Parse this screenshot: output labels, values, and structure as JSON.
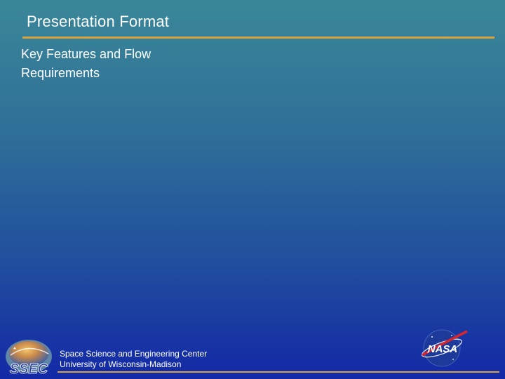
{
  "slide": {
    "title": "Presentation Format",
    "body_lines": [
      "Key Features and Flow",
      "Requirements"
    ]
  },
  "footer": {
    "org_line1": "Space Science and Engineering Center",
    "org_line2": "University of Wisconsin-Madison",
    "ssec_logo_text": "SSEC",
    "nasa_logo_text": "NASA"
  },
  "colors": {
    "background_top": "#3a8799",
    "background_bottom": "#1329a6",
    "accent_rule": "#d9a23c",
    "text": "#ffffff"
  }
}
